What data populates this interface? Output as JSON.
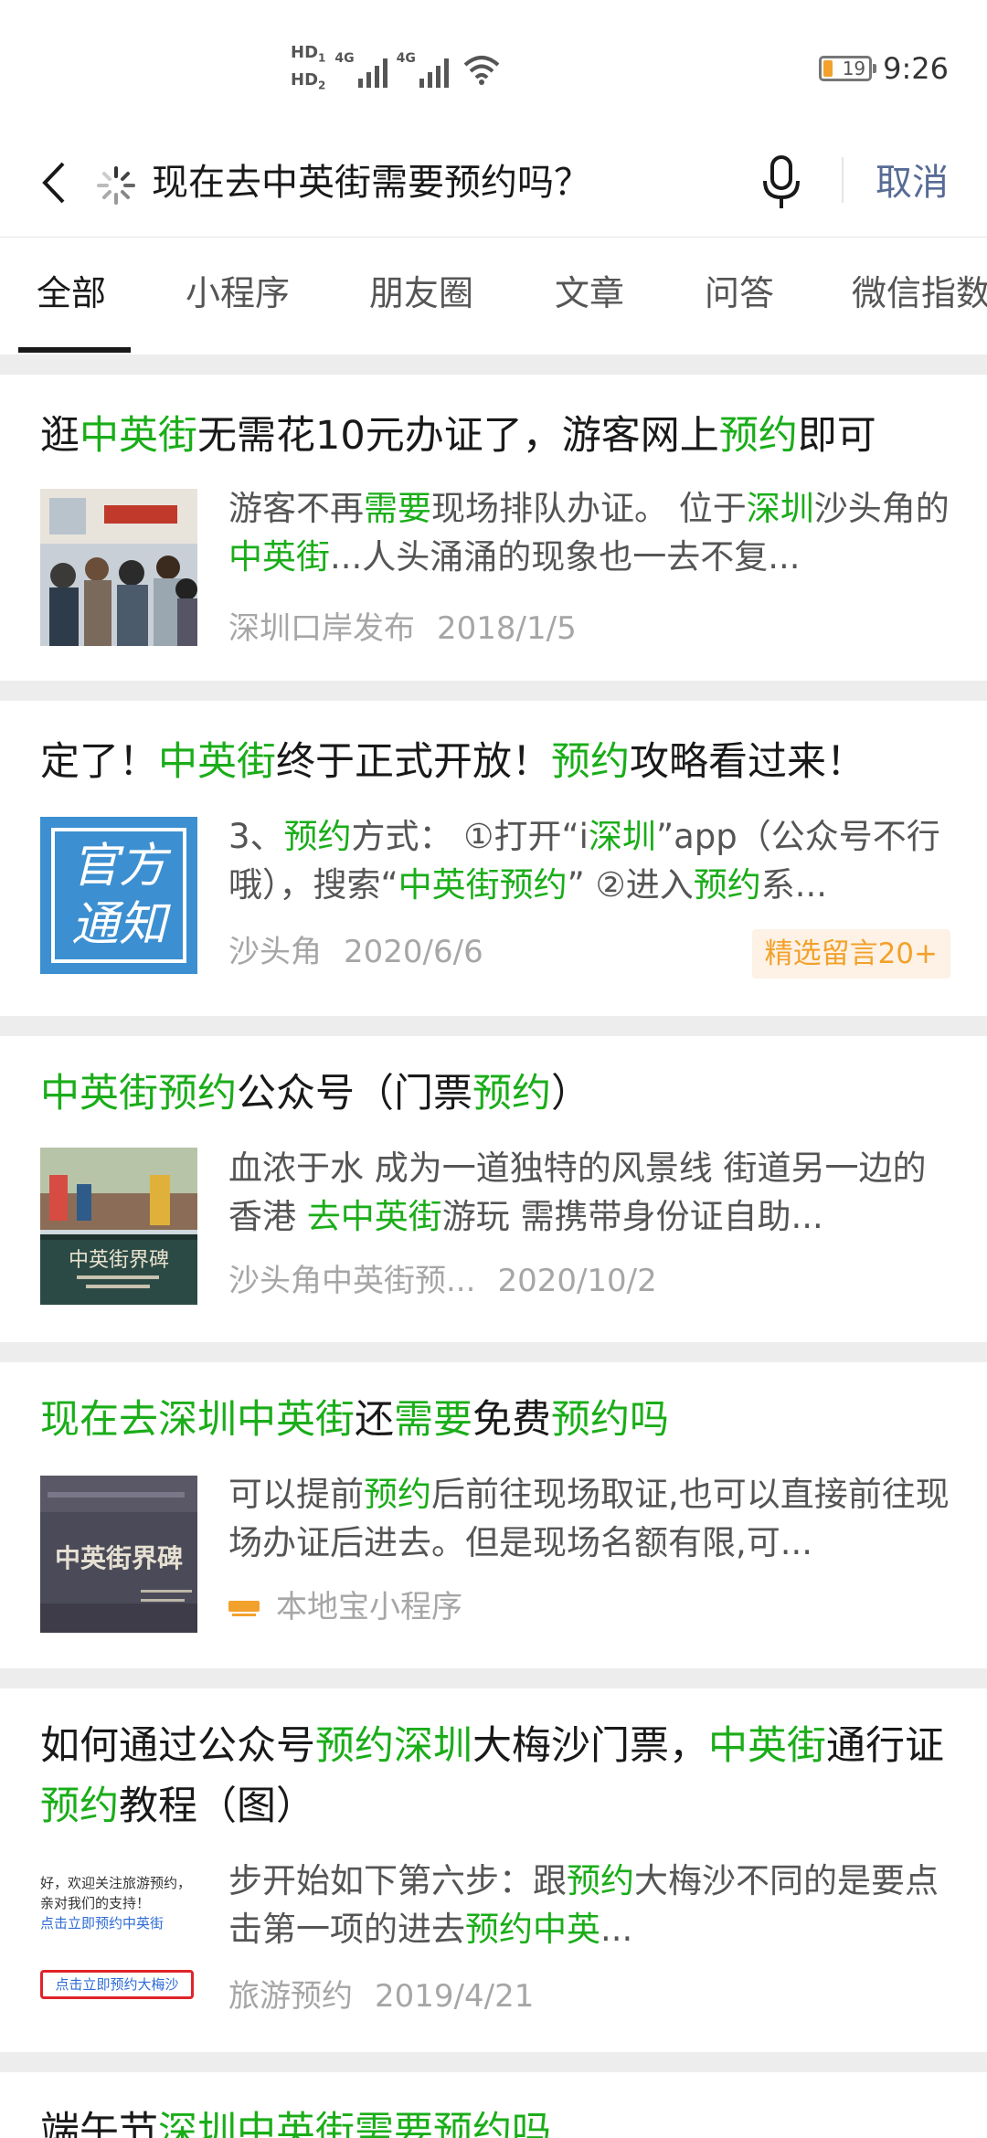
{
  "status_bar": {
    "hd1": "HD",
    "hd1_sub": "1",
    "hd2": "HD",
    "hd2_sub": "2",
    "sig1_label": "4G",
    "sig2_label": "4G",
    "battery": "19",
    "time": "9:26",
    "icons": [
      "signal-icon",
      "wifi-icon",
      "battery-icon"
    ]
  },
  "search": {
    "query": "现在去中英街需要预约吗？",
    "cancel_label": "取消",
    "icons": [
      "back-icon",
      "loading-icon",
      "mic-icon"
    ]
  },
  "tabs": [
    "全部",
    "小程序",
    "朋友圈",
    "文章",
    "问答",
    "微信指数"
  ],
  "results": [
    {
      "title": [
        [
          "逛",
          false
        ],
        [
          "中英街",
          true
        ],
        [
          "无需花10元办证了，游客网上",
          false
        ],
        [
          "预约",
          true
        ],
        [
          "即可",
          false
        ]
      ],
      "snippet": [
        [
          "游客不再",
          false
        ],
        [
          "需要",
          true
        ],
        [
          "现场排队办证。 位于",
          false
        ],
        [
          "深圳",
          true
        ],
        [
          "沙头角的",
          false
        ],
        [
          "中英街",
          true
        ],
        [
          "...人头涌涌的现象也一去不复...",
          false
        ]
      ],
      "source": "深圳口岸发布",
      "date": "2018/1/5"
    },
    {
      "title": [
        [
          "定了！",
          false
        ],
        [
          "中英街",
          true
        ],
        [
          "终于正式开放！",
          false
        ],
        [
          "预约",
          true
        ],
        [
          "攻略看过来！",
          false
        ]
      ],
      "snippet": [
        [
          "3、",
          false
        ],
        [
          "预约",
          true
        ],
        [
          "方式： ①打开“i",
          false
        ],
        [
          "深圳",
          true
        ],
        [
          "”app（公众号不行哦），搜索“",
          false
        ],
        [
          "中英街预约",
          true
        ],
        [
          "” ②进入",
          false
        ],
        [
          "预约",
          true
        ],
        [
          "系...",
          false
        ]
      ],
      "source": "沙头角",
      "date": "2020/6/6",
      "badge": "精选留言20+",
      "thumb_text": [
        "官方",
        "通知"
      ]
    },
    {
      "title": [
        [
          "中英街预约",
          true
        ],
        [
          "公众号（门票",
          false
        ],
        [
          "预约",
          true
        ],
        [
          "）",
          false
        ]
      ],
      "snippet": [
        [
          "血浓于水 成为一道独特的风景线 街道另一边的香港 ",
          false
        ],
        [
          "去中英街",
          true
        ],
        [
          "游玩 需携带身份证自助...",
          false
        ]
      ],
      "source": "沙头角中英街预...",
      "date": "2020/10/2",
      "thumb_text": [
        "中英街界碑"
      ]
    },
    {
      "title": [
        [
          "现在去深圳中英街",
          true
        ],
        [
          "还",
          false
        ],
        [
          "需要",
          true
        ],
        [
          "免费",
          false
        ],
        [
          "预约吗",
          true
        ]
      ],
      "snippet": [
        [
          "可以提前",
          false
        ],
        [
          "预约",
          true
        ],
        [
          "后前往现场取证,也可以直接前往现场办证后进去。但是现场名额有限,可...",
          false
        ]
      ],
      "source": "本地宝小程序",
      "thumb_text": [
        "中英街界碑"
      ]
    },
    {
      "title": [
        [
          "如何通过公众号",
          false
        ],
        [
          "预约深圳",
          true
        ],
        [
          "大梅沙门票，",
          false
        ],
        [
          "中英街",
          true
        ],
        [
          "通行证",
          false
        ],
        [
          "预约",
          true
        ],
        [
          "教程（图）",
          false
        ]
      ],
      "snippet": [
        [
          "步开始如下第六步：跟",
          false
        ],
        [
          "预约",
          true
        ],
        [
          "大梅沙不同的是要点击第一项的进去",
          false
        ],
        [
          "预约中英",
          true
        ],
        [
          "...",
          false
        ]
      ],
      "source": "旅游预约",
      "date": "2019/4/21",
      "thumb_text": [
        "好，欢迎关注旅游预约，",
        "亲对我们的支持！",
        "点击立即预约中英街",
        "点击立即预约大梅沙"
      ]
    },
    {
      "title": [
        [
          "端午节",
          false
        ],
        [
          "深圳中英街需要预约吗",
          true
        ]
      ]
    }
  ]
}
